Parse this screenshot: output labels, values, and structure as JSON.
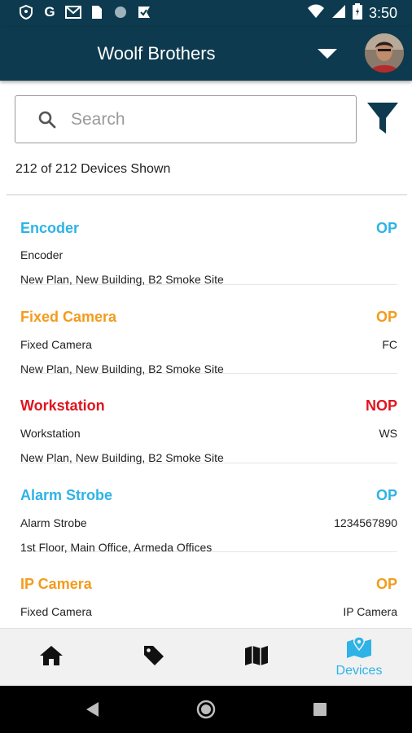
{
  "status_bar": {
    "time": "3:50",
    "icons": [
      "shield-info-icon",
      "google-icon",
      "gmail-icon",
      "sim-icon",
      "circle-icon",
      "check-badge-icon"
    ]
  },
  "header": {
    "title": "Woolf Brothers"
  },
  "search": {
    "placeholder": "Search",
    "value": ""
  },
  "summary": {
    "count_text": "212 of 212 Devices Shown"
  },
  "colors": {
    "header_bg": "#0d3a4e",
    "blue": "#2eb3e6",
    "orange": "#f39b1c",
    "red": "#e0141e"
  },
  "devices": [
    {
      "name": "Encoder",
      "status": "OP",
      "type": "Encoder",
      "code": "",
      "location": "New Plan, New Building, B2 Smoke Site",
      "color": "#2eb3e6"
    },
    {
      "name": "Fixed Camera",
      "status": "OP",
      "type": "Fixed Camera",
      "code": "FC",
      "location": "New Plan, New Building, B2 Smoke Site",
      "color": "#f39b1c"
    },
    {
      "name": "Workstation",
      "status": "NOP",
      "type": "Workstation",
      "code": "WS",
      "location": "New Plan, New Building, B2 Smoke Site",
      "color": "#e0141e"
    },
    {
      "name": "Alarm Strobe",
      "status": "OP",
      "type": "Alarm Strobe",
      "code": "1234567890",
      "location": "1st Floor, Main Office, Armeda Offices",
      "color": "#2eb3e6"
    },
    {
      "name": "IP Camera",
      "status": "OP",
      "type": "Fixed Camera",
      "code": "IP Camera",
      "location": "",
      "color": "#f39b1c"
    }
  ],
  "bottom_nav": {
    "items": [
      {
        "icon": "home-icon",
        "label": ""
      },
      {
        "icon": "tag-icon",
        "label": ""
      },
      {
        "icon": "map-icon",
        "label": ""
      },
      {
        "icon": "map-marker-icon",
        "label": "Devices"
      }
    ]
  }
}
